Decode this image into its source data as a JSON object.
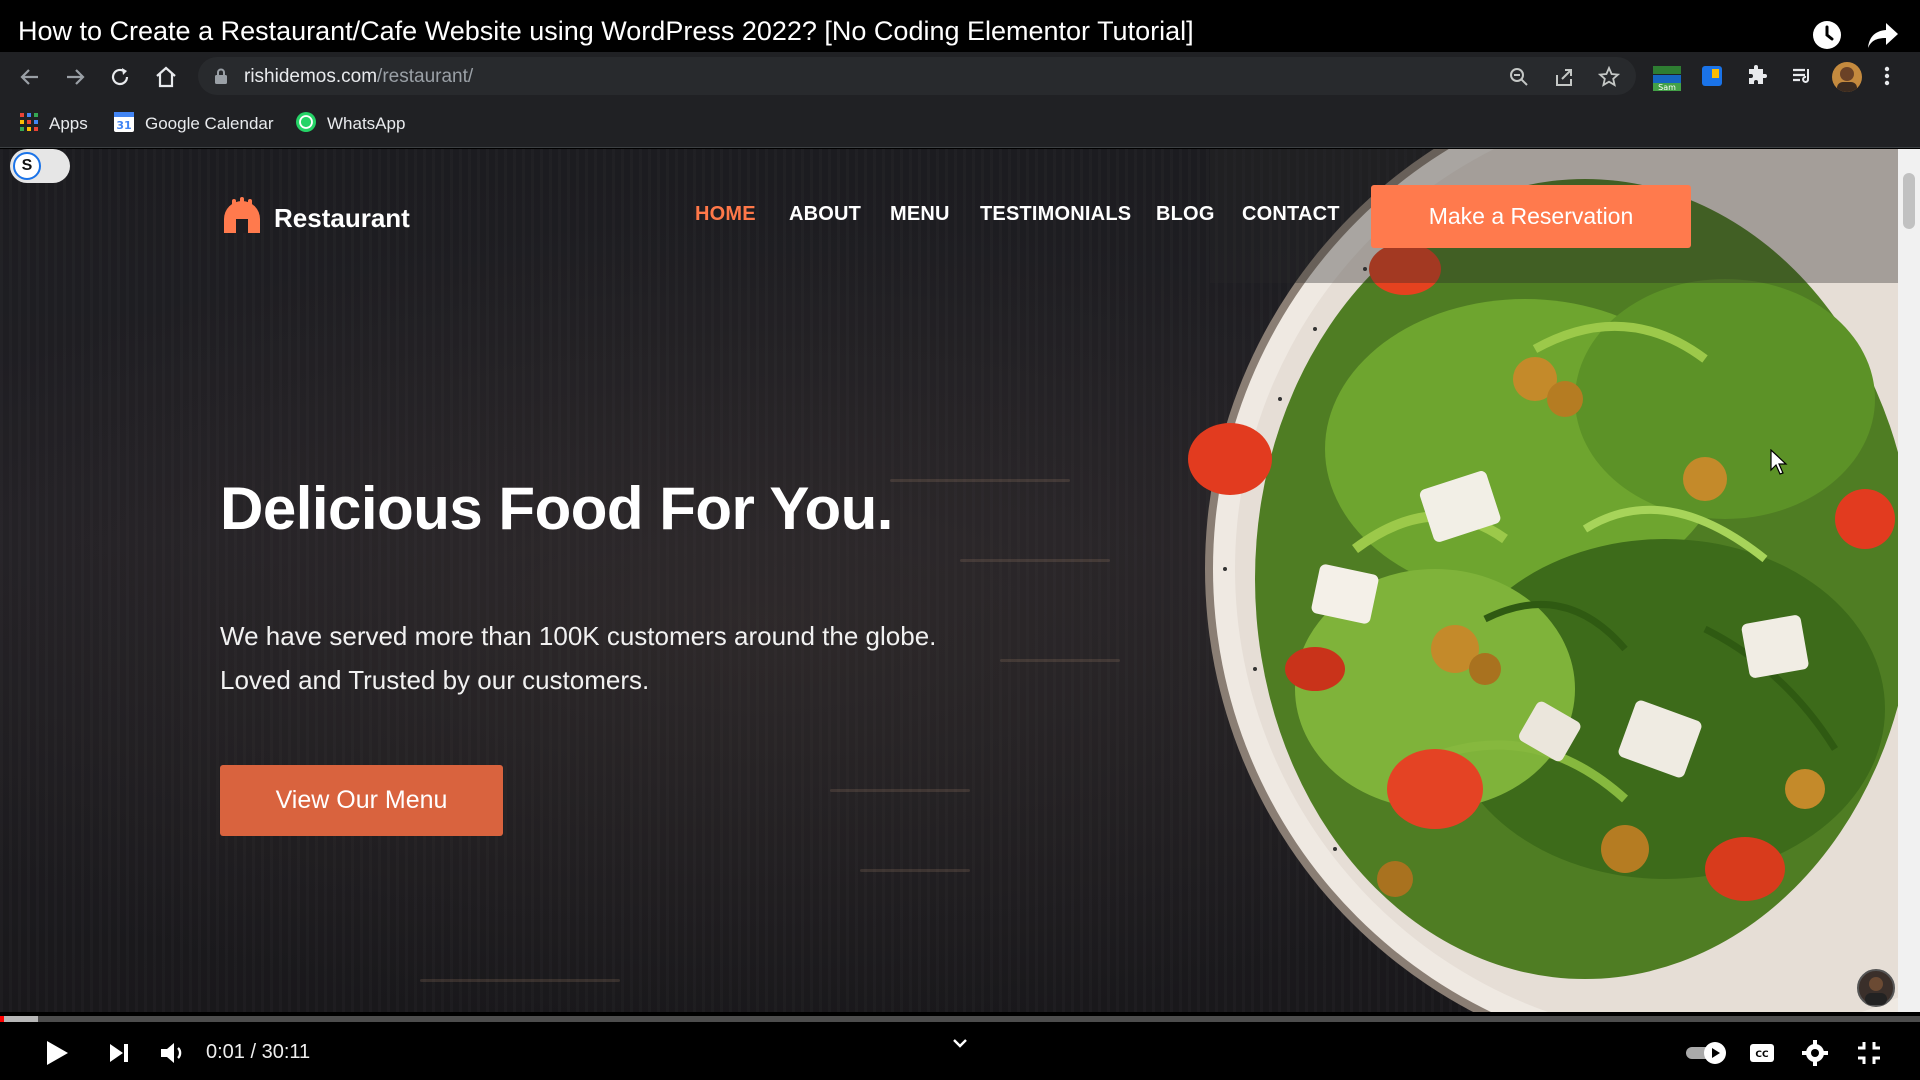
{
  "video": {
    "title": "How to Create a Restaurant/Cafe Website using WordPress 2022? [No Coding Elementor Tutorial]",
    "current_time": "0:01",
    "duration": "30:11",
    "time_display": "0:01 / 30:11",
    "progress": 0.0006
  },
  "browser": {
    "url_host": "rishidemos.com",
    "url_path": "/restaurant/",
    "bookmarks": [
      "Apps",
      "Google Calendar",
      "WhatsApp"
    ]
  },
  "site": {
    "toggle_letter": "S",
    "logo_text": "Restaurant",
    "nav": [
      "HOME",
      "ABOUT",
      "MENU",
      "TESTIMONIALS",
      "BLOG",
      "CONTACT"
    ],
    "active_nav": "HOME",
    "cta_label": "Make a Reservation",
    "hero_title": "Delicious Food For You.",
    "hero_subtitle": "We have served more than 100K customers around the globe. Loved and Trusted by our customers.",
    "menu_button_label": "View Our Menu"
  },
  "colors": {
    "accent": "#ff7a4d",
    "nav_active": "#ff7849",
    "menu_button": "#d9633e",
    "progress_played": "#ff0000"
  },
  "icons": {
    "yt": [
      "watch-later-icon",
      "share-icon"
    ],
    "browser": [
      "back-icon",
      "forward-icon",
      "reload-icon",
      "home-icon",
      "lock-icon",
      "zoom-icon",
      "share-page-icon",
      "bookmark-star-icon",
      "extensions-icon",
      "reading-list-icon",
      "profile-avatar",
      "kebab-menu-icon"
    ],
    "player": [
      "play-icon",
      "next-icon",
      "volume-icon",
      "chevron-down-icon",
      "autoplay-toggle",
      "captions-icon",
      "settings-icon",
      "exit-fullscreen-icon"
    ]
  }
}
